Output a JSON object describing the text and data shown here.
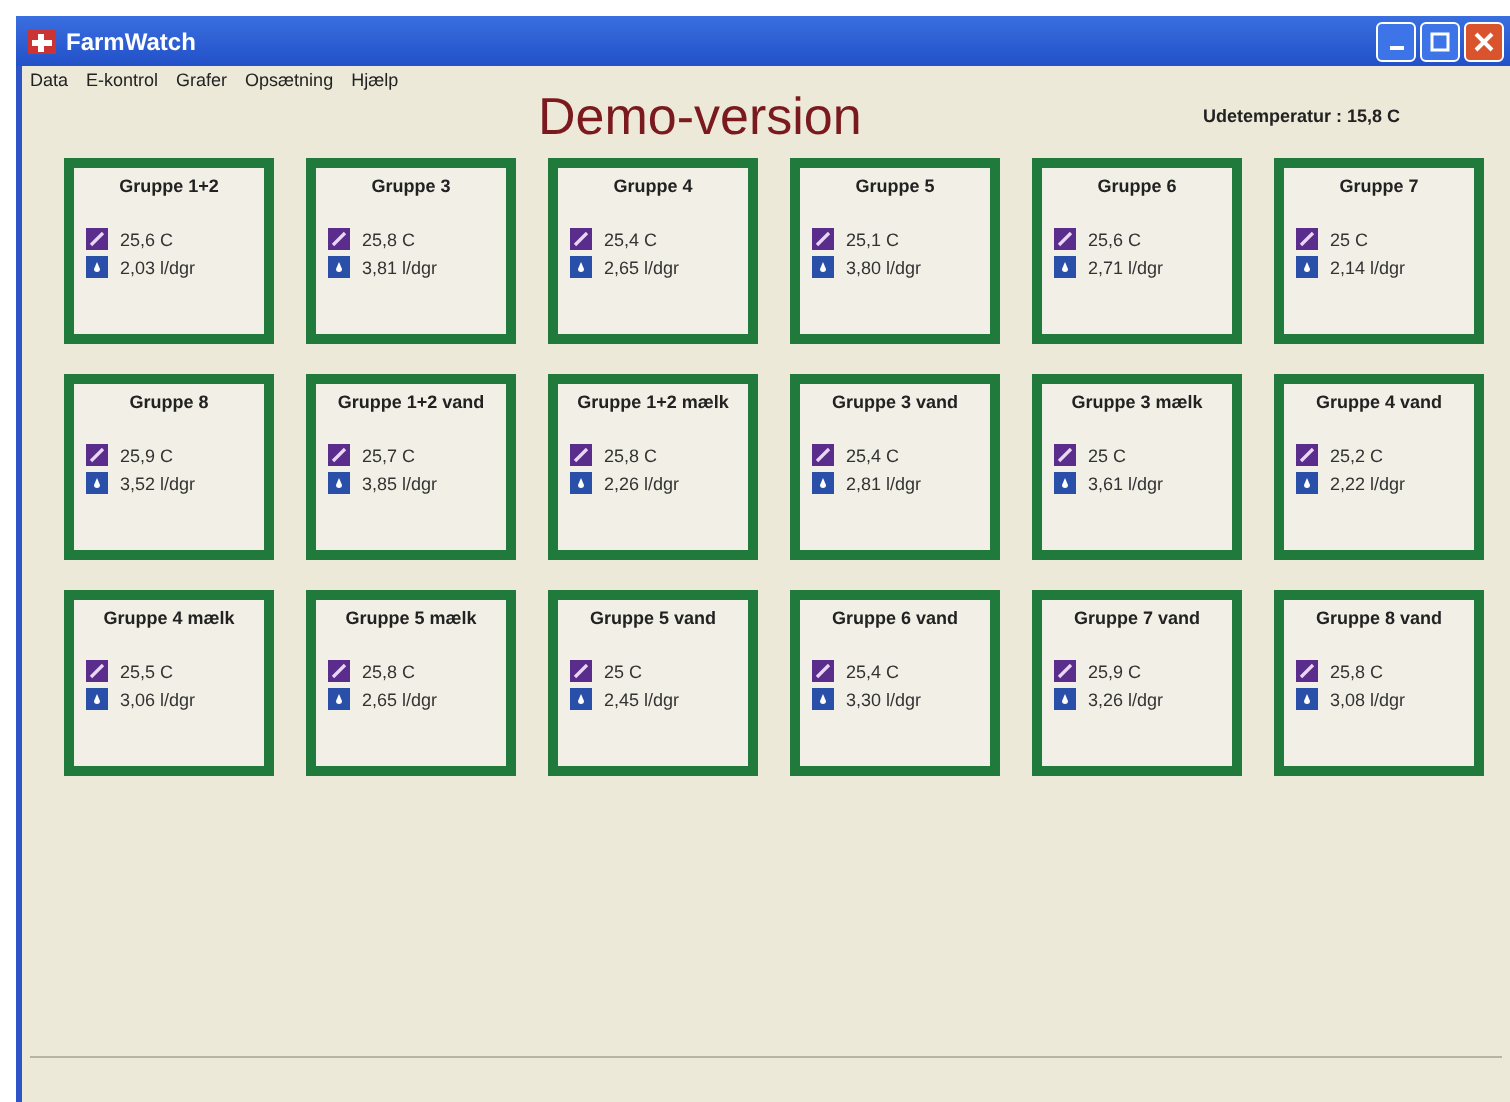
{
  "window": {
    "title": "FarmWatch"
  },
  "menu": [
    "Data",
    "E-kontrol",
    "Grafer",
    "Opsætning",
    "Hjælp"
  ],
  "banner": "Demo-version",
  "outdoor": "Udetemperatur : 15,8 C",
  "groups": [
    {
      "name": "Gruppe 1+2",
      "temp": "25,6 C",
      "flow": "2,03 l/dgr"
    },
    {
      "name": "Gruppe 3",
      "temp": "25,8 C",
      "flow": "3,81 l/dgr"
    },
    {
      "name": "Gruppe 4",
      "temp": "25,4 C",
      "flow": "2,65 l/dgr"
    },
    {
      "name": "Gruppe 5",
      "temp": "25,1 C",
      "flow": "3,80 l/dgr"
    },
    {
      "name": "Gruppe 6",
      "temp": "25,6 C",
      "flow": "2,71 l/dgr"
    },
    {
      "name": "Gruppe 7",
      "temp": "25 C",
      "flow": "2,14 l/dgr"
    },
    {
      "name": "Gruppe 8",
      "temp": "25,9 C",
      "flow": "3,52 l/dgr"
    },
    {
      "name": "Gruppe 1+2 vand",
      "temp": "25,7 C",
      "flow": "3,85 l/dgr"
    },
    {
      "name": "Gruppe 1+2 mælk",
      "temp": "25,8 C",
      "flow": "2,26 l/dgr"
    },
    {
      "name": "Gruppe 3 vand",
      "temp": "25,4 C",
      "flow": "2,81 l/dgr"
    },
    {
      "name": "Gruppe 3 mælk",
      "temp": "25 C",
      "flow": "3,61 l/dgr"
    },
    {
      "name": "Gruppe 4 vand",
      "temp": "25,2 C",
      "flow": "2,22 l/dgr"
    },
    {
      "name": "Gruppe 4 mælk",
      "temp": "25,5 C",
      "flow": "3,06 l/dgr"
    },
    {
      "name": "Gruppe 5 mælk",
      "temp": "25,8 C",
      "flow": "2,65 l/dgr"
    },
    {
      "name": "Gruppe 5 vand",
      "temp": "25 C",
      "flow": "2,45 l/dgr"
    },
    {
      "name": "Gruppe 6 vand",
      "temp": "25,4 C",
      "flow": "3,30 l/dgr"
    },
    {
      "name": "Gruppe 7 vand",
      "temp": "25,9 C",
      "flow": "3,26 l/dgr"
    },
    {
      "name": "Gruppe 8 vand",
      "temp": "25,8 C",
      "flow": "3,08 l/dgr"
    }
  ]
}
